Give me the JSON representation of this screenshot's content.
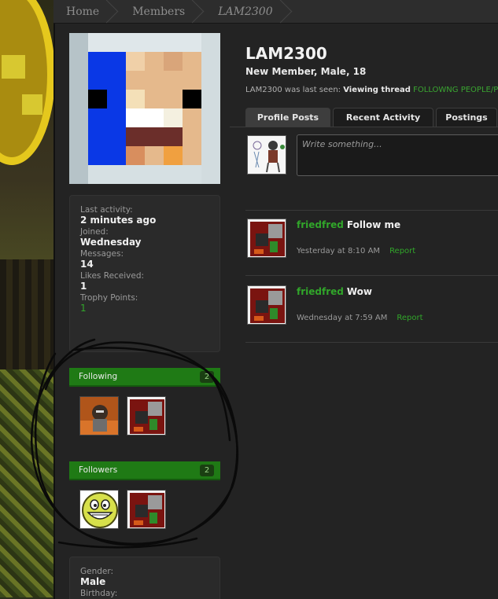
{
  "breadcrumb": {
    "items": [
      "Home",
      "Members",
      "LAM2300"
    ]
  },
  "profile": {
    "username": "LAM2300",
    "title": "New Member, Male, 18",
    "last_seen_prefix": "LAM2300 was last seen: ",
    "last_seen_action": "Viewing thread",
    "last_seen_thread": "FOLLOWNG PEOPLE/PEO"
  },
  "sidebar": {
    "stats": [
      {
        "label": "Last activity:",
        "value": "2 minutes ago"
      },
      {
        "label": "Joined:",
        "value": "Wednesday"
      },
      {
        "label": "Messages:",
        "value": "14"
      },
      {
        "label": "Likes Received:",
        "value": "1"
      },
      {
        "label": "Trophy Points:",
        "value": "1"
      }
    ],
    "following": {
      "label": "Following",
      "count": "2"
    },
    "followers": {
      "label": "Followers",
      "count": "2"
    },
    "gender_label": "Gender:",
    "gender_value": "Male",
    "birthday_label": "Birthday:"
  },
  "tabs": [
    {
      "label": "Profile Posts",
      "active": true
    },
    {
      "label": "Recent Activity",
      "active": false
    },
    {
      "label": "Postings",
      "active": false
    }
  ],
  "composer": {
    "placeholder": "Write something..."
  },
  "posts": [
    {
      "author": "friedfred",
      "text": "Follow me",
      "time": "Yesterday at 8:10 AM",
      "report": "Report"
    },
    {
      "author": "friedfred",
      "text": "Wow",
      "time": "Wednesday at 7:59 AM",
      "report": "Report"
    }
  ],
  "colors": {
    "accent_green": "#31a62a",
    "section_green": "#1f7a15",
    "background": "#232323"
  }
}
